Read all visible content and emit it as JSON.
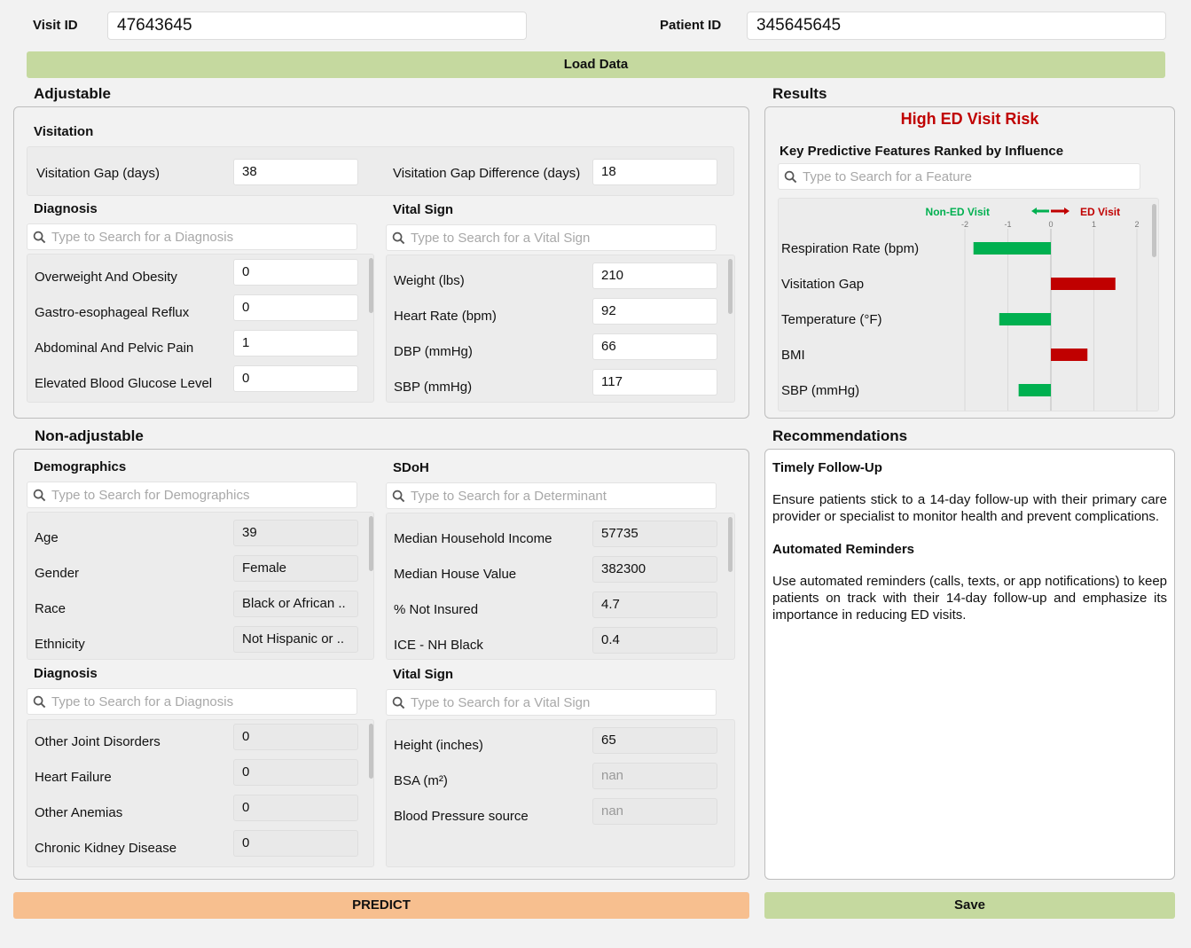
{
  "header": {
    "visit_id_label": "Visit ID",
    "visit_id_value": "47643645",
    "patient_id_label": "Patient ID",
    "patient_id_value": "345645645",
    "load_button": "Load Data"
  },
  "adjustable": {
    "title": "Adjustable",
    "visitation": {
      "title": "Visitation",
      "gap_label": "Visitation Gap (days)",
      "gap_value": "38",
      "gap_diff_label": "Visitation Gap Difference (days)",
      "gap_diff_value": "18"
    },
    "diagnosis": {
      "title": "Diagnosis",
      "search_placeholder": "Type to Search for a Diagnosis",
      "items": [
        {
          "label": "Overweight And Obesity",
          "value": "0"
        },
        {
          "label": "Gastro-esophageal Reflux",
          "value": "0"
        },
        {
          "label": "Abdominal And Pelvic Pain",
          "value": "1"
        },
        {
          "label": "Elevated Blood Glucose Level",
          "value": "0"
        }
      ]
    },
    "vital_sign": {
      "title": "Vital Sign",
      "search_placeholder": "Type to Search for a Vital Sign",
      "items": [
        {
          "label": "Weight (lbs)",
          "value": "210"
        },
        {
          "label": "Heart Rate (bpm)",
          "value": "92"
        },
        {
          "label": "DBP (mmHg)",
          "value": "66"
        },
        {
          "label": "SBP (mmHg)",
          "value": "117"
        }
      ]
    }
  },
  "non_adjustable": {
    "title": "Non-adjustable",
    "demographics": {
      "title": "Demographics",
      "search_placeholder": "Type to Search for Demographics",
      "items": [
        {
          "label": "Age",
          "value": "39"
        },
        {
          "label": "Gender",
          "value": "Female"
        },
        {
          "label": "Race",
          "value": "Black or African .."
        },
        {
          "label": "Ethnicity",
          "value": "Not Hispanic or .."
        }
      ]
    },
    "sdoh": {
      "title": "SDoH",
      "search_placeholder": "Type to Search for a Determinant",
      "items": [
        {
          "label": "Median Household Income",
          "value": "57735"
        },
        {
          "label": "Median House Value",
          "value": "382300"
        },
        {
          "label": "% Not Insured",
          "value": "4.7"
        },
        {
          "label": "ICE - NH Black",
          "value": "0.4"
        }
      ]
    },
    "diagnosis": {
      "title": "Diagnosis",
      "search_placeholder": "Type to Search for a Diagnosis",
      "items": [
        {
          "label": "Other Joint Disorders",
          "value": "0"
        },
        {
          "label": "Heart Failure",
          "value": "0"
        },
        {
          "label": "Other Anemias",
          "value": "0"
        },
        {
          "label": "Chronic Kidney Disease",
          "value": "0"
        }
      ]
    },
    "vital_sign": {
      "title": "Vital Sign",
      "search_placeholder": "Type to Search for a Vital Sign",
      "items": [
        {
          "label": "Height (inches)",
          "value": "65"
        },
        {
          "label": "BSA (m²)",
          "value": "nan"
        },
        {
          "label": "Blood Pressure source",
          "value": "nan"
        }
      ]
    }
  },
  "results": {
    "title": "Results",
    "risk_text": "High ED Visit Risk",
    "risk_color": "#c00000",
    "features_title": "Key Predictive Features Ranked by Influence",
    "search_placeholder": "Type to Search for a Feature",
    "legend_neg": "Non-ED Visit",
    "legend_pos": "ED Visit",
    "neg_color": "#00b050",
    "pos_color": "#c00000"
  },
  "chart_data": {
    "type": "bar",
    "orientation": "horizontal",
    "categories": [
      "Respiration Rate (bpm)",
      "Visitation Gap",
      "Temperature (°F)",
      "BMI",
      "SBP (mmHg)"
    ],
    "values": [
      -1.8,
      1.5,
      -1.2,
      0.85,
      -0.75
    ],
    "xlim": [
      -2,
      2
    ],
    "xticks": [
      "-2",
      "-1",
      "0",
      "1",
      "2"
    ],
    "grid": true
  },
  "recommendations": {
    "title": "Recommendations",
    "sections": [
      {
        "heading": "Timely Follow-Up",
        "body": "Ensure patients stick to a 14-day follow-up with their primary care provider or specialist to monitor health and prevent complications."
      },
      {
        "heading": "Automated Reminders",
        "body": "Use automated reminders (calls, texts, or app notifications) to keep patients on track with their 14-day follow-up and emphasize its importance in reducing ED visits."
      }
    ]
  },
  "footer": {
    "predict_button": "PREDICT",
    "save_button": "Save"
  }
}
